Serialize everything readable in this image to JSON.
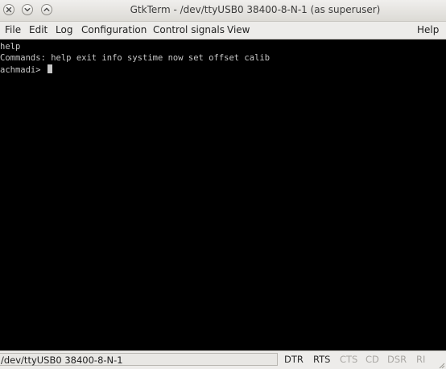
{
  "window": {
    "title": "GtkTerm - /dev/ttyUSB0  38400-8-N-1 (as superuser)"
  },
  "menu": {
    "file": "File",
    "edit": "Edit",
    "log": "Log",
    "configuration": "Configuration",
    "control_signals": "Control signals",
    "view": "View",
    "help": "Help"
  },
  "terminal": {
    "lines": [
      "help",
      "Commands: help exit info systime now set offset calib",
      "achmadi> "
    ]
  },
  "status": {
    "port": "/dev/ttyUSB0  38400-8-N-1",
    "signals": {
      "dtr": "DTR",
      "rts": "RTS",
      "cts": "CTS",
      "cd": "CD",
      "dsr": "DSR",
      "ri": "RI"
    }
  },
  "colors": {
    "terminal_bg": "#000000",
    "terminal_fg": "#c7c7c7",
    "signal_active": "#2a2a2a",
    "signal_inactive": "#a9a7a3"
  }
}
